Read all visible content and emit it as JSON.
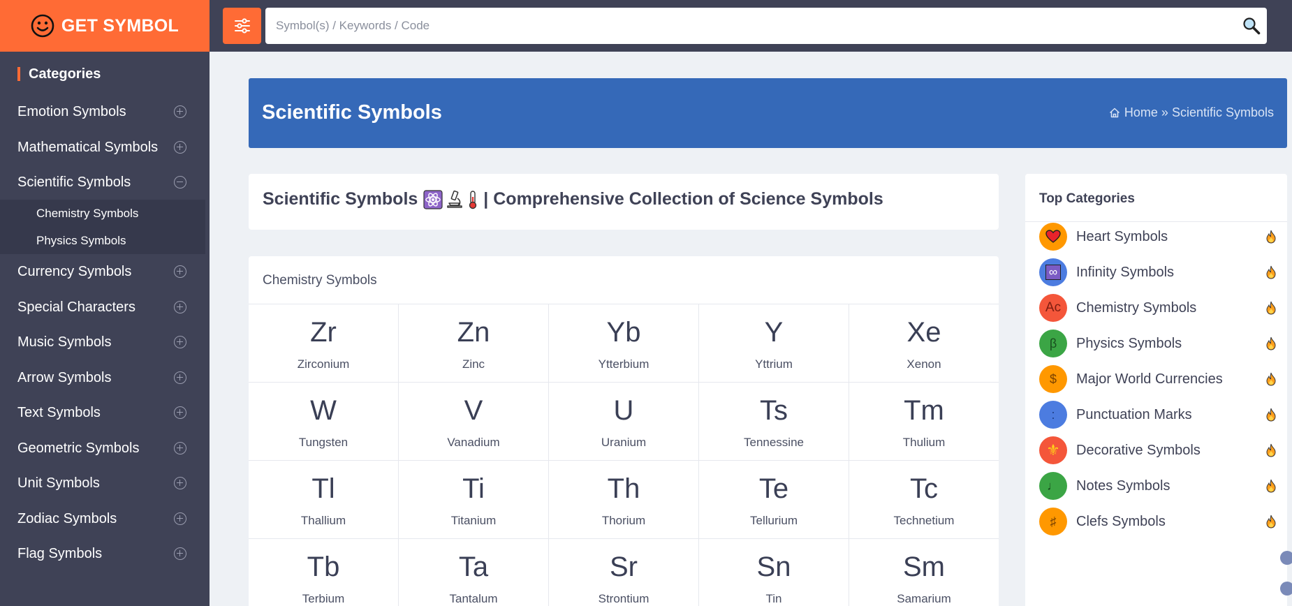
{
  "brand": {
    "name": "GET SYMBOL",
    "logo_icon": "smiley-face-icon"
  },
  "search": {
    "placeholder": "Symbol(s) / Keywords / Code",
    "filter_icon": "sliders-icon",
    "search_icon": "magnifier-icon"
  },
  "sidebar": {
    "heading": "Categories",
    "items": [
      {
        "label": "Emotion Symbols",
        "state": "collapsed"
      },
      {
        "label": "Mathematical Symbols",
        "state": "collapsed"
      },
      {
        "label": "Scientific Symbols",
        "state": "expanded"
      },
      {
        "label": "Currency Symbols",
        "state": "collapsed"
      },
      {
        "label": "Special Characters",
        "state": "collapsed"
      },
      {
        "label": "Music Symbols",
        "state": "collapsed"
      },
      {
        "label": "Arrow Symbols",
        "state": "collapsed"
      },
      {
        "label": "Text Symbols",
        "state": "collapsed"
      },
      {
        "label": "Geometric Symbols",
        "state": "collapsed"
      },
      {
        "label": "Unit Symbols",
        "state": "collapsed"
      },
      {
        "label": "Zodiac Symbols",
        "state": "collapsed"
      },
      {
        "label": "Flag Symbols",
        "state": "collapsed"
      }
    ],
    "subitems": [
      "Chemistry Symbols",
      "Physics Symbols"
    ]
  },
  "banner": {
    "title": "Scientific Symbols",
    "breadcrumb": {
      "home": "Home",
      "separator": "»",
      "current": "Scientific Symbols"
    }
  },
  "page": {
    "title_prefix": "Scientific Symbols",
    "title_emojis": [
      "atom-emoji",
      "microscope-emoji",
      "thermometer-emoji"
    ],
    "title_suffix": "| Comprehensive Collection of Science Symbols"
  },
  "chemistry": {
    "heading": "Chemistry Symbols",
    "elements": [
      {
        "symbol": "Zr",
        "name": "Zirconium"
      },
      {
        "symbol": "Zn",
        "name": "Zinc"
      },
      {
        "symbol": "Yb",
        "name": "Ytterbium"
      },
      {
        "symbol": "Y",
        "name": "Yttrium"
      },
      {
        "symbol": "Xe",
        "name": "Xenon"
      },
      {
        "symbol": "W",
        "name": "Tungsten"
      },
      {
        "symbol": "V",
        "name": "Vanadium"
      },
      {
        "symbol": "U",
        "name": "Uranium"
      },
      {
        "symbol": "Ts",
        "name": "Tennessine"
      },
      {
        "symbol": "Tm",
        "name": "Thulium"
      },
      {
        "symbol": "Tl",
        "name": "Thallium"
      },
      {
        "symbol": "Ti",
        "name": "Titanium"
      },
      {
        "symbol": "Th",
        "name": "Thorium"
      },
      {
        "symbol": "Te",
        "name": "Tellurium"
      },
      {
        "symbol": "Tc",
        "name": "Technetium"
      },
      {
        "symbol": "Tb",
        "name": "Terbium"
      },
      {
        "symbol": "Ta",
        "name": "Tantalum"
      },
      {
        "symbol": "Sr",
        "name": "Strontium"
      },
      {
        "symbol": "Sn",
        "name": "Tin"
      },
      {
        "symbol": "Sm",
        "name": "Samarium"
      }
    ]
  },
  "top_categories": {
    "heading": "Top Categories",
    "trend_icon": "fire-icon",
    "items": [
      {
        "label": "Heart Symbols",
        "glyph": "❤",
        "icon": "heart-icon",
        "color": "#ff9800"
      },
      {
        "label": "Infinity Symbols",
        "glyph": "∞",
        "icon": "infinity-icon",
        "color": "#4c7ce0"
      },
      {
        "label": "Chemistry Symbols",
        "glyph": "Ac",
        "icon": "actinium-icon",
        "color": "#f4563a"
      },
      {
        "label": "Physics Symbols",
        "glyph": "β",
        "icon": "beta-icon",
        "color": "#3ba545"
      },
      {
        "label": "Major World Currencies",
        "glyph": "$",
        "icon": "dollar-icon",
        "color": "#ff9800"
      },
      {
        "label": "Punctuation Marks",
        "glyph": ":",
        "icon": "colon-icon",
        "color": "#4c7ce0"
      },
      {
        "label": "Decorative Symbols",
        "glyph": "⚜",
        "icon": "fleur-de-lis-icon",
        "color": "#f4563a"
      },
      {
        "label": "Notes Symbols",
        "glyph": "♩",
        "icon": "quarter-note-icon",
        "color": "#3ba545"
      },
      {
        "label": "Clefs Symbols",
        "glyph": "♯",
        "icon": "sharp-icon",
        "color": "#ff9800"
      }
    ]
  }
}
